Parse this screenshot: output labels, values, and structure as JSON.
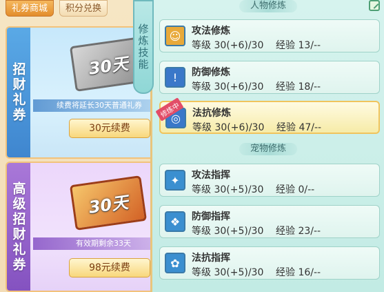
{
  "shop": {
    "tabs": [
      "礼券商城",
      "积分兑换"
    ],
    "cards": [
      {
        "title": "招财礼券",
        "ticket_text": "30天",
        "note": "续费将延长30天普通礼券",
        "button": "30元续费"
      },
      {
        "title": "高级招财礼券",
        "ticket_text": "30天",
        "note": "有效期剩余33天",
        "button": "98元续费"
      }
    ]
  },
  "side_tab": "修炼技能",
  "sections": {
    "character": "人物修炼",
    "pet": "宠物修炼"
  },
  "character_skills": [
    {
      "name": "攻法修炼",
      "level": "等级 30(+6)/30",
      "exp": "经验 13/--",
      "icon": "person-icon",
      "icon_color": "#e8a93a"
    },
    {
      "name": "防御修炼",
      "level": "等级 30(+6)/30",
      "exp": "经验 18/--",
      "icon": "shield-icon",
      "icon_color": "#3a78c9"
    },
    {
      "name": "法抗修炼",
      "level": "等级 30(+6)/30",
      "exp": "经验 47/--",
      "icon": "magic-resist-icon",
      "icon_color": "#3a78c9",
      "badge": "修炼中",
      "active": true
    }
  ],
  "pet_skills": [
    {
      "name": "攻法指挥",
      "level": "等级 30(+5)/30",
      "exp": "经验 0/--",
      "icon": "claw-icon",
      "icon_color": "#3b8fd0"
    },
    {
      "name": "防御指挥",
      "level": "等级 30(+5)/30",
      "exp": "经验 23/--",
      "icon": "paw-shield-icon",
      "icon_color": "#3b8fd0"
    },
    {
      "name": "法抗指挥",
      "level": "等级 30(+5)/30",
      "exp": "经验 16/--",
      "icon": "paw-magic-icon",
      "icon_color": "#3b8fd0"
    }
  ]
}
